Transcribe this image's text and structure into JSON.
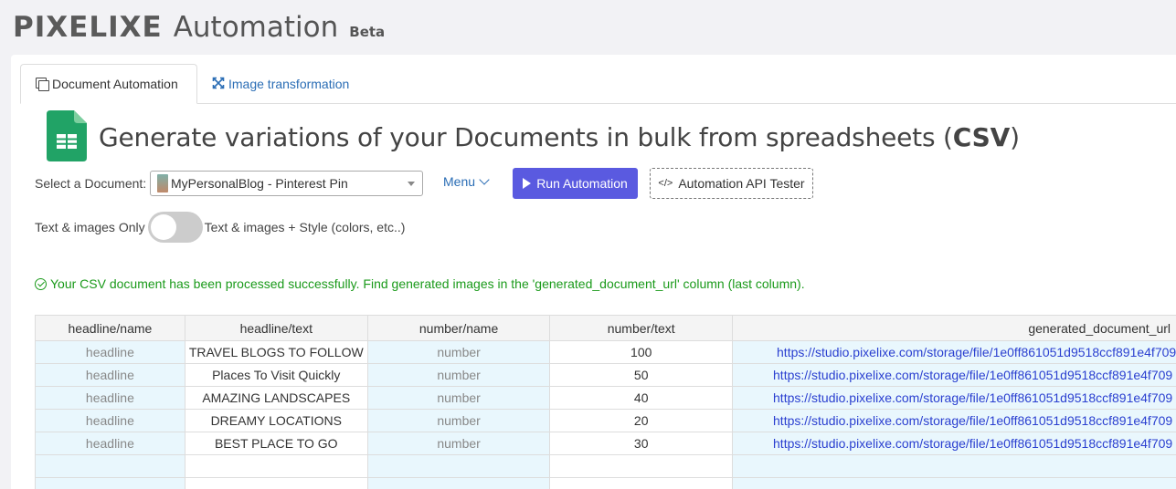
{
  "brand": {
    "logo": "PIXELIXE",
    "title": "Automation",
    "badge": "Beta"
  },
  "tabs": [
    {
      "label": "Document Automation",
      "icon": "copy-icon",
      "active": true
    },
    {
      "label": "Image transformation",
      "icon": "expand-icon",
      "active": false
    }
  ],
  "heading": {
    "prefix": "Generate variations of your Documents in bulk from spreadsheets (",
    "bold": "CSV",
    "suffix": ")"
  },
  "controls": {
    "select_label": "Select a Document:",
    "selected_document": "MyPersonalBlog - Pinterest Pin",
    "menu_label": "Menu",
    "run_label": "Run Automation",
    "api_label": "Automation API Tester",
    "toggle_left": "Text & images Only",
    "toggle_right": "Text & images + Style (colors, etc..)"
  },
  "message": "Your CSV document has been processed successfully. Find generated images in the 'generated_document_url' column (last column).",
  "table": {
    "columns": [
      "headline/name",
      "headline/text",
      "number/name",
      "number/text",
      "generated_document_url"
    ],
    "rows": [
      [
        "headline",
        "TRAVEL BLOGS TO FOLLOW",
        "number",
        "100",
        "https://studio.pixelixe.com/storage/file/1e0ff861051d9518ccf891e4f709"
      ],
      [
        "headline",
        "Places To Visit Quickly",
        "number",
        "50",
        "https://studio.pixelixe.com/storage/file/1e0ff861051d9518ccf891e4f709"
      ],
      [
        "headline",
        "AMAZING LANDSCAPES",
        "number",
        "40",
        "https://studio.pixelixe.com/storage/file/1e0ff861051d9518ccf891e4f709"
      ],
      [
        "headline",
        "DREAMY LOCATIONS",
        "number",
        "20",
        "https://studio.pixelixe.com/storage/file/1e0ff861051d9518ccf891e4f709"
      ],
      [
        "headline",
        "BEST PLACE TO GO",
        "number",
        "30",
        "https://studio.pixelixe.com/storage/file/1e0ff861051d9518ccf891e4f709"
      ],
      [
        "",
        "",
        "",
        "",
        ""
      ],
      [
        "",
        "",
        "",
        "",
        ""
      ]
    ]
  },
  "colors": {
    "accent": "#5a5ae0",
    "link": "#2a6db5",
    "success": "#1a9a1a",
    "readonly_cell": "#e9f7fd",
    "sheet_green": "#21a366"
  }
}
